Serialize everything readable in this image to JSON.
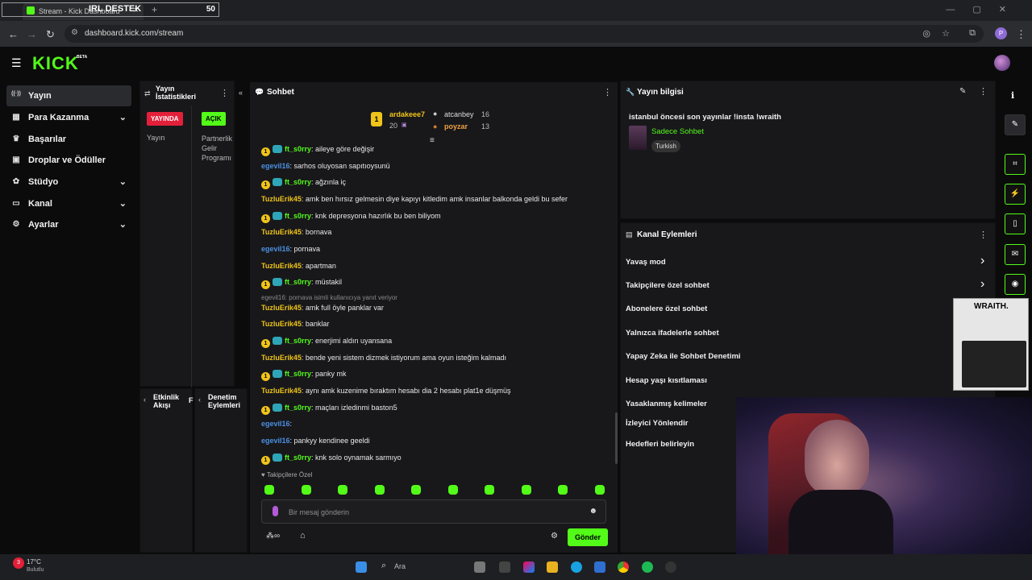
{
  "browser": {
    "tab_title": "Stream - Kick Dashboard",
    "overlay_title": "IRL DESTEK",
    "overlay_count": "50",
    "url": "dashboard.kick.com/stream",
    "profile_initial": "P"
  },
  "app": {
    "logo": "KICK",
    "beta": "BETA"
  },
  "sidebar": {
    "items": [
      {
        "label": "Yayın",
        "icon": "broadcast-icon",
        "active": true
      },
      {
        "label": "Para Kazanma",
        "icon": "money-icon",
        "chevron": true
      },
      {
        "label": "Başarılar",
        "icon": "trophy-icon"
      },
      {
        "label": "Droplar ve Ödüller",
        "icon": "gift-icon"
      },
      {
        "label": "Stüdyo",
        "icon": "palette-icon",
        "chevron": true
      },
      {
        "label": "Kanal",
        "icon": "tv-icon",
        "chevron": true
      },
      {
        "label": "Ayarlar",
        "icon": "gear-icon",
        "chevron": true
      }
    ]
  },
  "stats_panel": {
    "title": "Yayın İstatistikleri",
    "live_badge": "YAYINDA",
    "open_badge": "AÇIK",
    "col1_label": "Yayın",
    "col2_label": "Partnerlik Gelir Programı"
  },
  "activity_panel": {
    "title": "Etkinlik Akışı",
    "next_letter": "F"
  },
  "moderation_panel": {
    "title": "Denetim Eylemleri"
  },
  "chat": {
    "title": "Sohbet",
    "leaderboard": [
      {
        "rank": "1",
        "name": "ardakeee7",
        "value": "20"
      },
      {
        "rank": "",
        "name": "atcanbey",
        "value": "16"
      },
      {
        "rank": "",
        "name": "poyzar",
        "value": "13"
      }
    ],
    "messages": [
      {
        "user": "ft_s0rry",
        "text": ": aileye göre değişir",
        "badge": true,
        "color": "#53fc18"
      },
      {
        "user": "egevil16",
        "text": ": sarhos oluyosan sapıtıoysunü",
        "badge": false,
        "color": "#4a90e2"
      },
      {
        "user": "ft_s0rry",
        "text": ": ağzınla iç",
        "badge": true,
        "color": "#53fc18"
      },
      {
        "user": "TuzluErik45",
        "text": ": amk ben hırsız gelmesin diye kapıyı kitledim amk insanlar balkonda geldi bu sefer",
        "badge": false,
        "color": "#f0c419"
      },
      {
        "user": "ft_s0rry",
        "text": ": knk depresyona hazırlık bu ben biliyom",
        "badge": true,
        "color": "#53fc18"
      },
      {
        "user": "TuzluErik45",
        "text": ": bornava",
        "badge": false,
        "color": "#f0c419"
      },
      {
        "user": "egevil16",
        "text": ": pornava",
        "badge": false,
        "color": "#4a90e2"
      },
      {
        "user": "TuzluErik45",
        "text": ": apartman",
        "badge": false,
        "color": "#f0c419"
      },
      {
        "user": "ft_s0rry",
        "text": ": müstakil",
        "badge": true,
        "color": "#53fc18"
      },
      {
        "reply": "egevil16: pornava isimli kullanıcıya yanıt veriyor"
      },
      {
        "user": "TuzluErik45",
        "text": ": amk full öyle panklar var",
        "badge": false,
        "color": "#f0c419"
      },
      {
        "user": "TuzluErik45",
        "text": ": banklar",
        "badge": false,
        "color": "#f0c419"
      },
      {
        "user": "ft_s0rry",
        "text": ": enerjimi aldın uyansana",
        "badge": true,
        "color": "#53fc18"
      },
      {
        "user": "TuzluErik45",
        "text": ": bende yeni sistem dizmek istiyorum ama oyun isteğim kalmadı",
        "badge": false,
        "color": "#f0c419"
      },
      {
        "user": "ft_s0rry",
        "text": ": panky mk",
        "badge": true,
        "color": "#53fc18"
      },
      {
        "user": "TuzluErik45",
        "text": ": aynı amk kuzenime bıraktım hesabı dia 2 hesabı plat1e düşmüş",
        "badge": false,
        "color": "#f0c419"
      },
      {
        "user": "ft_s0rry",
        "text": ": maçları izledinmi baston5",
        "badge": true,
        "color": "#53fc18"
      },
      {
        "user": "egevil16",
        "text": ": ",
        "badge": false,
        "color": "#4a90e2"
      },
      {
        "user": "egevil16",
        "text": ": pankyy kendinee geeldi",
        "badge": false,
        "color": "#4a90e2"
      },
      {
        "user": "ft_s0rry",
        "text": ": knk solo oynamak sarmıyo",
        "badge": true,
        "color": "#53fc18"
      }
    ],
    "followers_only": "Takipçilere Özel",
    "input_placeholder": "Bir mesaj gönderin",
    "send_label": "Gönder"
  },
  "stream_info": {
    "title": "Yayın bilgisi",
    "stream_title": "istanbul öncesi son yayınlar !insta !wraith",
    "category": "Sadece Sohbet",
    "language": "Turkish"
  },
  "channel_actions": {
    "title": "Kanal Eylemleri",
    "items": [
      {
        "label": "Yavaş mod",
        "chevron": true
      },
      {
        "label": "Takipçilere özel sohbet",
        "chevron": true
      },
      {
        "label": "Abonelere özel sohbet"
      },
      {
        "label": "Yalnızca ifadelerle sohbet"
      },
      {
        "label": "Yapay Zeka ile Sohbet Denetimi"
      },
      {
        "label": "Hesap yaşı kısıtlaması"
      },
      {
        "label": "Yasaklanmış kelimeler"
      },
      {
        "label": "İzleyici Yönlendir"
      },
      {
        "label": "Hedefleri belirleyin"
      }
    ]
  },
  "ad": {
    "brand": "WRAITH."
  },
  "taskbar": {
    "weather_temp": "17°C",
    "weather_desc": "Bulutlu",
    "notif_count": "3",
    "search_label": "Ara"
  }
}
